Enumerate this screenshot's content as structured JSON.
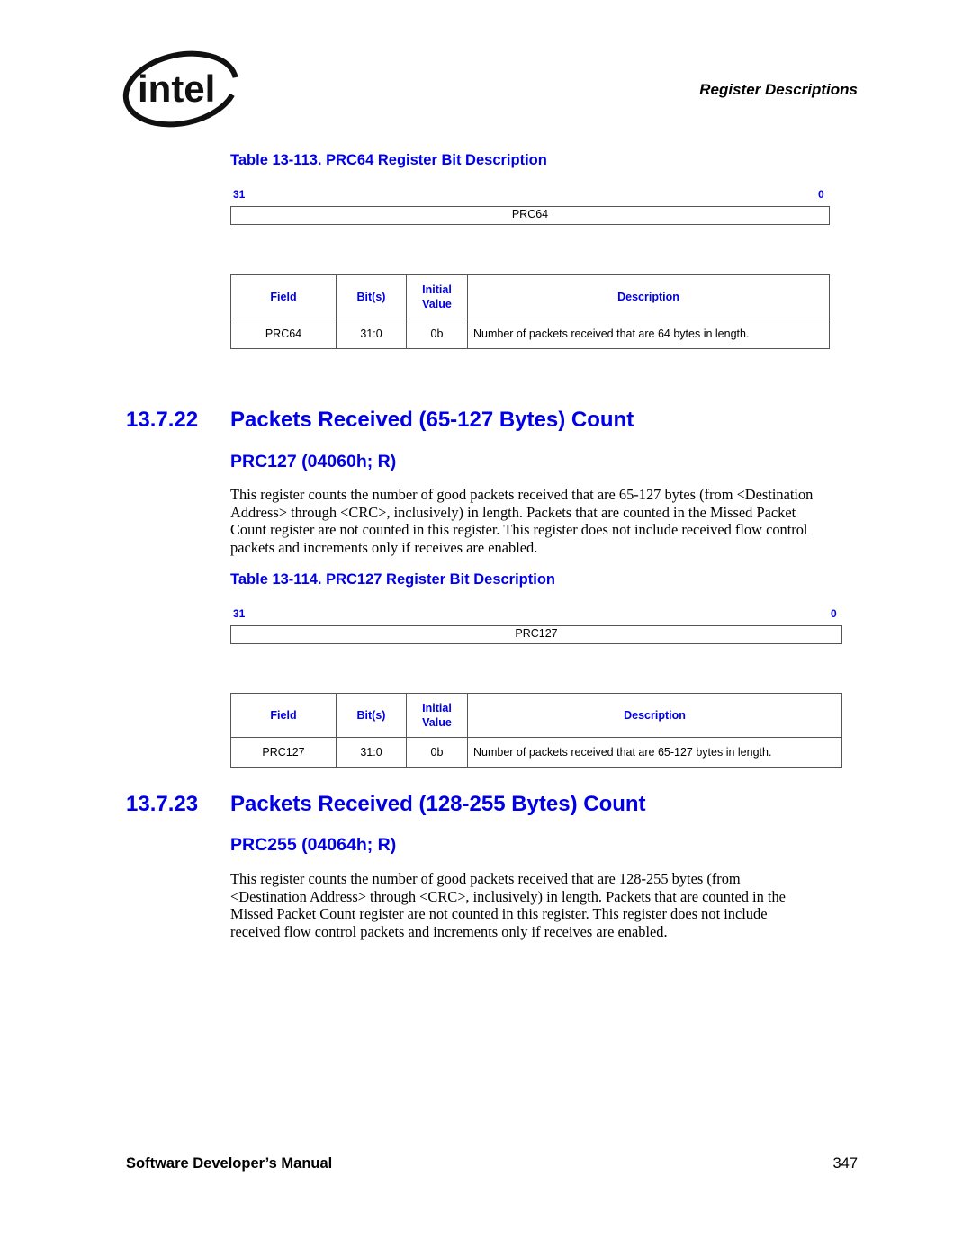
{
  "header": {
    "logo": "intel-logo",
    "logo_text": "intel",
    "running_head": "Register Descriptions"
  },
  "colors": {
    "heading_blue": "#0000e6",
    "text": "#000000",
    "border": "#555555"
  },
  "table_113": {
    "title": "Table 13-113. PRC64 Register Bit Description",
    "bit_high": "31",
    "bit_low": "0",
    "register_label": "PRC64",
    "headers": [
      "Field",
      "Bit(s)",
      "Initial Value",
      "Description"
    ],
    "header_initial_line1": "Initial",
    "header_initial_line2": "Value",
    "rows": [
      {
        "field": "PRC64",
        "bits": "31:0",
        "initial": "0b",
        "description": "Number of packets received that are 64 bytes in length."
      }
    ]
  },
  "section_22": {
    "number": "13.7.22",
    "title": "Packets Received (65-127 Bytes) Count",
    "register": "PRC127 (04060h; R)",
    "paragraph_lines": [
      "This register counts the number of good packets received that are 65-127 bytes (from <Destination",
      "Address> through <CRC>, inclusively) in length. Packets that are counted in the Missed Packet",
      "Count register are not counted in this register. This register does not include received flow control",
      "packets and increments only if receives are enabled."
    ]
  },
  "table_114": {
    "title": "Table 13-114. PRC127 Register Bit Description",
    "bit_high": "31",
    "bit_low": "0",
    "register_label": "PRC127",
    "headers": [
      "Field",
      "Bit(s)",
      "Initial Value",
      "Description"
    ],
    "header_initial_line1": "Initial",
    "header_initial_line2": "Value",
    "rows": [
      {
        "field": "PRC127",
        "bits": "31:0",
        "initial": "0b",
        "description": "Number of packets received that are 65-127 bytes in length."
      }
    ]
  },
  "section_23": {
    "number": "13.7.23",
    "title": "Packets Received (128-255 Bytes) Count",
    "register": "PRC255 (04064h; R)",
    "paragraph_lines": [
      "This register counts the number of good packets received that are 128-255 bytes (from",
      "<Destination Address> through <CRC>, inclusively) in length. Packets that are counted in the",
      "Missed Packet Count register are not counted in this register. This register does not include",
      "received flow control packets and increments only if receives are enabled."
    ]
  },
  "footer": {
    "manual_title": "Software Developer’s Manual",
    "page_number": "347"
  }
}
